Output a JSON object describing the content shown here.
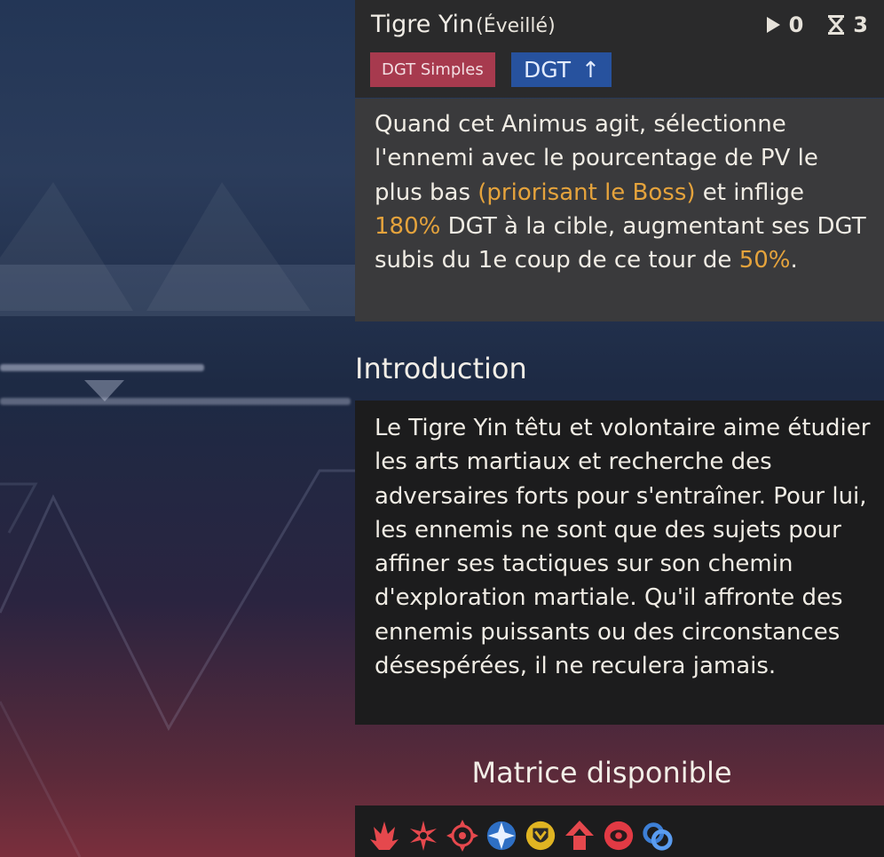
{
  "skill": {
    "name": "Tigre Yin",
    "state": "(Éveillé)",
    "counters": [
      {
        "icon": "play-icon",
        "value": "0"
      },
      {
        "icon": "hourglass-icon",
        "value": "3"
      }
    ],
    "tags": [
      {
        "label": "DGT Simples",
        "color": "#a73a4e"
      },
      {
        "label": "DGT",
        "symbol": "↑",
        "color": "#27529e"
      }
    ],
    "description": {
      "p1": "Quand cet Animus agit, sélectionne l'ennemi avec le pourcentage de PV le plus bas ",
      "h1": "(priorisant le Boss)",
      "p2": " et inflige ",
      "h2": "180%",
      "p3": " DGT à la cible, augmentant ses DGT subis du 1e coup de ce tour de ",
      "h3": "50%",
      "p4": "."
    },
    "highlight_color": "#e5a33c"
  },
  "introduction": {
    "title": "Introduction",
    "text": "Le Tigre Yin têtu et volontaire aime étudier les arts martiaux et recherche des adversaires forts pour s'entraîner. Pour lui, les ennemis ne sont que des sujets pour affiner ses tactiques sur son chemin d'exploration martiale. Qu'il affronte des ennemis puissants ou des circonstances désespérées, il ne reculera jamais."
  },
  "matrix": {
    "title": "Matrice disponible",
    "icons": [
      "flame-crown-icon",
      "red-burst-icon",
      "crosshair-icon",
      "blue-compass-star-icon",
      "yellow-shield-icon",
      "red-arrow-emblem-icon",
      "red-orb-icon",
      "blue-chain-link-icon"
    ]
  }
}
